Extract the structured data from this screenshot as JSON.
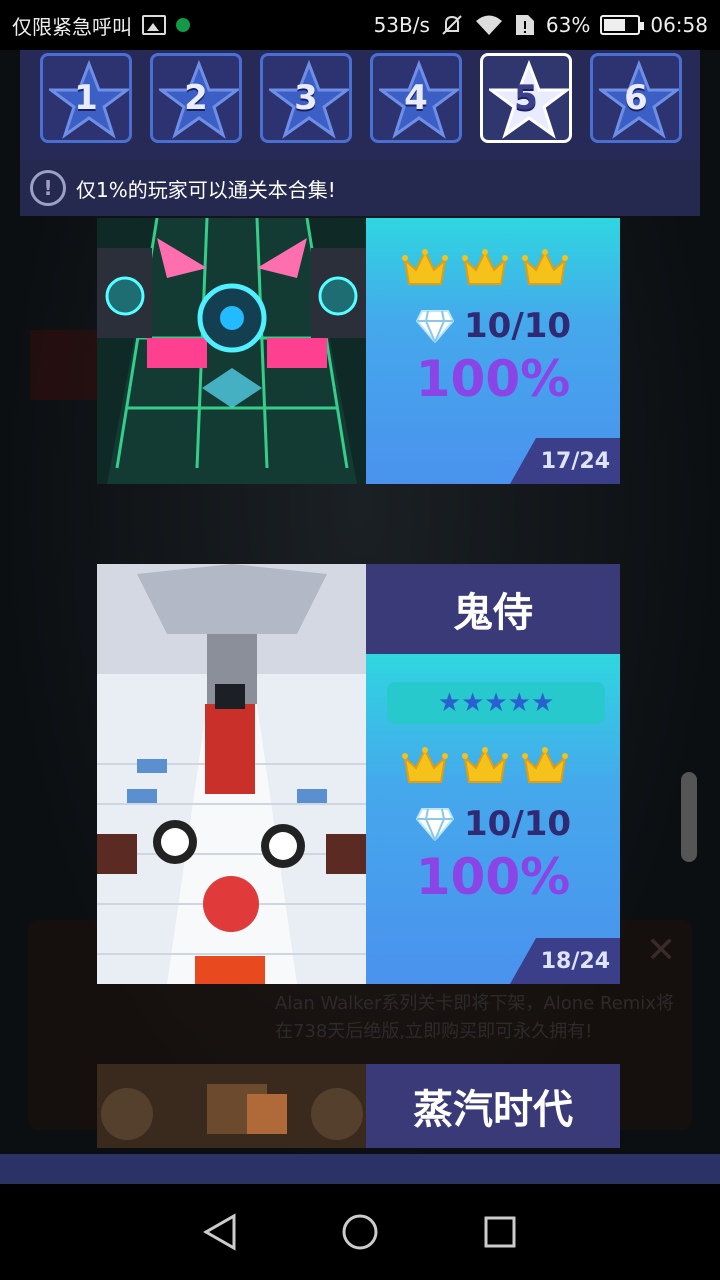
{
  "status_bar": {
    "carrier": "仅限紧急呼叫",
    "speed": "53B/s",
    "battery": "63%",
    "time": "06:58"
  },
  "stage_tabs": [
    "1",
    "2",
    "3",
    "4",
    "5",
    "6"
  ],
  "active_stage": "5",
  "notice": "仅1%的玩家可以通关本合集!",
  "cards": [
    {
      "title": "",
      "crowns": 3,
      "gems": "10/10",
      "percent": "100%",
      "index": "17/24"
    },
    {
      "title": "鬼侍",
      "stars": "★★★★★",
      "crowns": 3,
      "gems": "10/10",
      "percent": "100%",
      "index": "18/24"
    },
    {
      "title": "蒸汽时代"
    }
  ],
  "popup_text": "Alan Walker系列关卡即将下架，Alone Remix将在738天后绝版,立即购买即可永久拥有!",
  "colors": {
    "panel": "#272a56",
    "tab_border": "#4a6fd2",
    "stats_gradient_top": "#2fd6e0",
    "percent": "#8b44e6",
    "crown": "#f4c21b"
  },
  "icons": [
    "gallery-icon",
    "mute-icon",
    "wifi-icon",
    "sim-alert-icon",
    "battery-icon",
    "info-icon",
    "crown-icon",
    "diamond-icon",
    "back-icon",
    "home-icon",
    "recents-icon"
  ]
}
